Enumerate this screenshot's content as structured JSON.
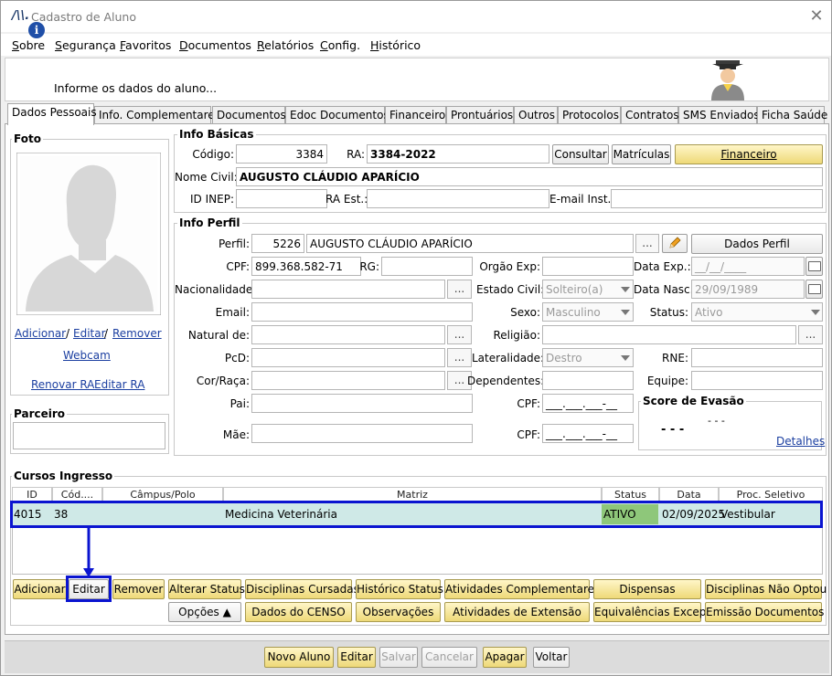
{
  "window": {
    "logo": "/\\\\.",
    "title": "Cadastro de Aluno",
    "close": "✕"
  },
  "menu": [
    "Sobre",
    "Segurança",
    "Favoritos",
    "Documentos",
    "Relatórios",
    "Config.",
    "Histórico"
  ],
  "info": {
    "icon": "i",
    "text": "Informe os dados do aluno..."
  },
  "tabs": [
    "Dados Pessoais",
    "Info. Complementares",
    "Documentos",
    "Edoc Documentos",
    "Financeiro",
    "Prontuários",
    "Outros",
    "Protocolos",
    "Contratos",
    "SMS Enviados",
    "Ficha Saúde"
  ],
  "foto": {
    "title": "Foto",
    "adicionar": "Adicionar",
    "sep1": "/",
    "editar": "Editar",
    "sep2": "/",
    "remover": "Remover",
    "webcam": "Webcam",
    "renovar_ra": "Renovar RA",
    "editar_ra": "Editar RA"
  },
  "parceiro": {
    "title": "Parceiro"
  },
  "info_basicas": {
    "title": "Info Básicas",
    "codigo_label": "Código:",
    "codigo": "3384",
    "ra_label": "RA:",
    "ra": "3384-2022",
    "consultar": "Consultar",
    "matriculas": "Matrículas",
    "financeiro": "Financeiro",
    "nome_label": "Nome Civil:",
    "nome": "AUGUSTO CLÁUDIO APARÍCIO",
    "inep_label": "ID INEP:",
    "ra_est_label": "RA Est.:",
    "email_inst_label": "E-mail Inst.:"
  },
  "info_perfil": {
    "title": "Info Perfil",
    "perfil_label": "Perfil:",
    "perfil_id": "5226",
    "perfil_nome": "AUGUSTO CLÁUDIO APARÍCIO",
    "dots": "...",
    "dados_perfil": "Dados Perfil",
    "cpf_label": "CPF:",
    "cpf": "899.368.582-71",
    "rg_label": "RG:",
    "orgao_label": "Orgão Exp:",
    "data_exp_label": "Data Exp.:",
    "data_exp": "__/__/____",
    "nacionalidade_label": "Nacionalidade:",
    "estado_civil_label": "Estado Civil:",
    "estado_civil": "Solteiro(a)",
    "data_nasc_label": "Data Nasc.:",
    "data_nasc": "29/09/1989",
    "email_label": "Email:",
    "sexo_label": "Sexo:",
    "sexo": "Masculino",
    "status_label": "Status:",
    "status": "Ativo",
    "natural_label": "Natural de:",
    "religiao_label": "Religião:",
    "pcd_label": "PcD:",
    "lateralidade_label": "Lateralidade:",
    "lateralidade": "Destro",
    "rne_label": "RNE:",
    "cor_label": "Cor/Raça:",
    "dependentes_label": "Dependentes:",
    "equipe_label": "Equipe:",
    "pai_label": "Pai:",
    "cpf_pai_label": "CPF:",
    "cpf_pai": "___.___.___-__",
    "mae_label": "Mãe:",
    "cpf_mae_label": "CPF:",
    "cpf_mae": "___.___.___-__",
    "score_title": "Score de Evasão",
    "score_value": "- - -",
    "score_sub": "- - -",
    "detalhes": "Detalhes"
  },
  "cursos": {
    "title": "Cursos Ingresso",
    "headers": [
      "ID",
      "Cód....",
      "Câmpus/Polo",
      "Matriz",
      "Status",
      "Data",
      "Proc. Seletivo"
    ],
    "row": {
      "id": "4015",
      "cod": "38",
      "campus": "",
      "matriz": "Medicina Veterinária",
      "status": "ATIVO",
      "data": "02/09/2025",
      "proc": "Vestibular"
    }
  },
  "row1_buttons": [
    "Adicionar",
    "Editar",
    "Remover",
    "Alterar Status",
    "Disciplinas Cursadas",
    "Histórico Status",
    "Atividades Complementares",
    "Dispensas",
    "Disciplinas Não Optou"
  ],
  "row2_buttons": [
    "Opções ▲",
    "Dados do CENSO",
    "Observações",
    "Atividades de Extensão",
    "Equivalências Excep.",
    "Emissão Documentos"
  ],
  "bottom_buttons": [
    "Novo Aluno",
    "Editar",
    "Salvar",
    "Cancelar",
    "Apagar",
    "Voltar"
  ],
  "colors": {
    "highlight": "#0a14d0",
    "row_bg": "#cfe9e7",
    "status_bg": "#8ec77a",
    "gold": "#eed978"
  }
}
